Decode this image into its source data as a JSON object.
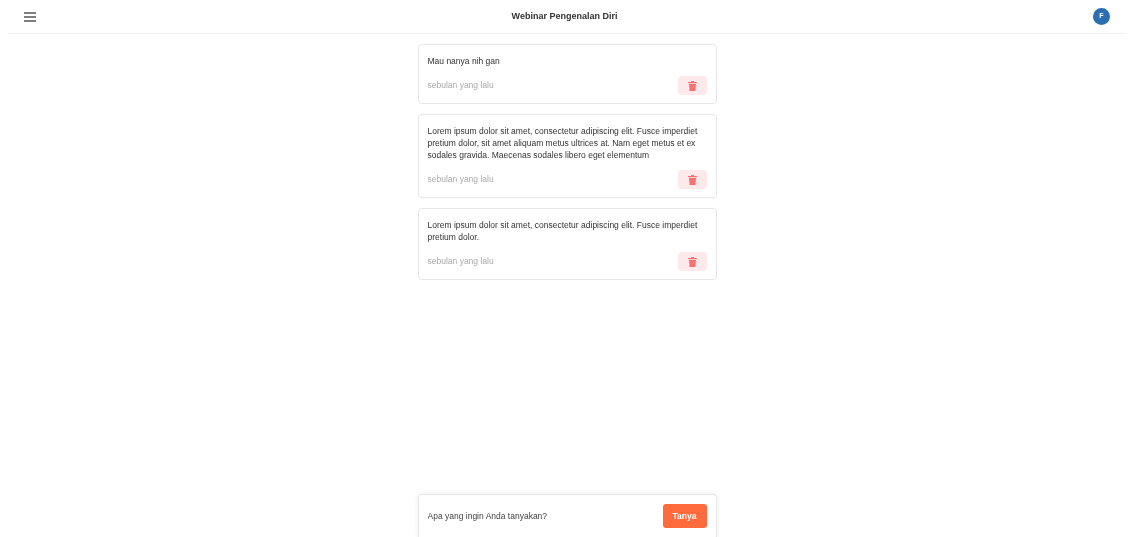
{
  "header": {
    "title": "Webinar Pengenalan Diri",
    "avatar": "F"
  },
  "questions": [
    {
      "text": "Mau nanya nih gan",
      "time": "sebulan yang lalu"
    },
    {
      "text": "Lorem ipsum dolor sit amet, consectetur adipiscing elit. Fusce imperdiet pretium dolor, sit amet aliquam metus ultrices at. Nam eget metus et ex sodales gravida. Maecenas sodales libero eget elementum",
      "time": "sebulan yang lalu"
    },
    {
      "text": "Lorem ipsum dolor sit amet, consectetur adipiscing elit. Fusce imperdiet pretium dolor.",
      "time": "sebulan yang lalu"
    }
  ],
  "composer": {
    "placeholder": "Apa yang ingin Anda tanyakan?",
    "button": "Tanya"
  }
}
